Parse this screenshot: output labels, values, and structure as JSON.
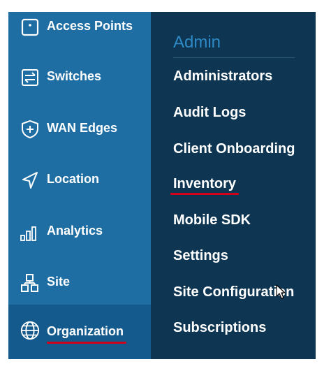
{
  "sidebar": {
    "items": [
      {
        "label": "Access Points",
        "icon": "access-point-icon"
      },
      {
        "label": "Switches",
        "icon": "switch-icon"
      },
      {
        "label": "WAN Edges",
        "icon": "wan-edge-icon"
      },
      {
        "label": "Location",
        "icon": "location-icon"
      },
      {
        "label": "Analytics",
        "icon": "analytics-icon"
      },
      {
        "label": "Site",
        "icon": "site-icon"
      },
      {
        "label": "Organization",
        "icon": "globe-icon"
      }
    ]
  },
  "admin_menu": {
    "title": "Admin",
    "items": [
      {
        "label": "Administrators"
      },
      {
        "label": "Audit Logs"
      },
      {
        "label": "Client Onboarding"
      },
      {
        "label": "Inventory"
      },
      {
        "label": "Mobile SDK"
      },
      {
        "label": "Settings"
      },
      {
        "label": "Site Configuration"
      },
      {
        "label": "Subscriptions"
      }
    ]
  },
  "colors": {
    "sidebar_bg": "#1f6ea3",
    "sidebar_active_bg": "#155a8c",
    "panel_bg": "#0e3552",
    "panel_title": "#2e8ac6",
    "annotation_underline": "#d0021b"
  }
}
